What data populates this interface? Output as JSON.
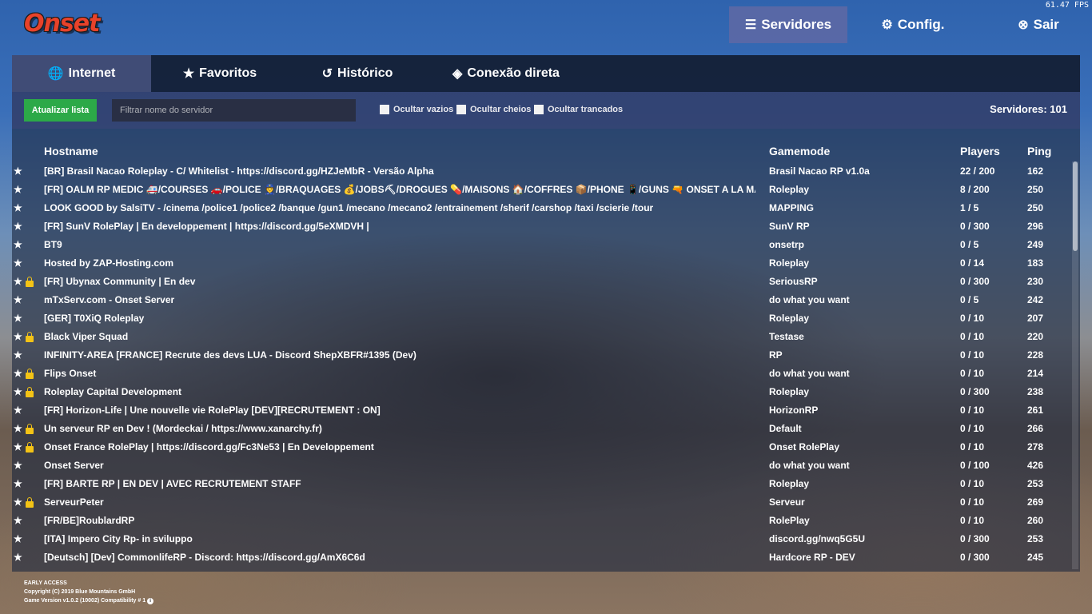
{
  "app": {
    "logo_text": "Onset",
    "fps": "61.47 FPS"
  },
  "topnav": {
    "servers": "Servidores",
    "config": "Config.",
    "exit": "Sair"
  },
  "tabs": [
    {
      "label": "Internet",
      "icon": "globe-icon",
      "active": true
    },
    {
      "label": "Favoritos",
      "icon": "star-icon",
      "active": false
    },
    {
      "label": "Histórico",
      "icon": "history-icon",
      "active": false
    },
    {
      "label": "Conexão direta",
      "icon": "direction-sign-icon",
      "active": false
    }
  ],
  "toolbar": {
    "refresh_label": "Atualizar lista",
    "filter_placeholder": "Filtrar nome do servidor",
    "hide_empty": "Ocultar vazios",
    "hide_full": "Ocultar cheios",
    "hide_locked": "Ocultar trancados",
    "server_count": "Servidores: 101"
  },
  "columns": {
    "hostname": "Hostname",
    "gamemode": "Gamemode",
    "players": "Players",
    "ping": "Ping"
  },
  "servers": [
    {
      "host": "[BR] Brasil Nacao Roleplay  - C/ Whitelist - https://discord.gg/HZJeMbR - Versão Alpha",
      "mode": "Brasil Nacao RP v1.0a",
      "players": "22 / 200",
      "ping": "162",
      "locked": false
    },
    {
      "host": "[FR] OALM RP MEDIC 🚑/COURSES 🚗/POLICE 👮/BRAQUAGES 💰/JOBS⛏/DROGUES 💊/MAISONS 🏠/COFFRES 📦/PHONE 📱/GUNS 🔫 ONSET A LA MAISON",
      "mode": "Roleplay",
      "players": "8 / 200",
      "ping": "250",
      "locked": false
    },
    {
      "host": "LOOK GOOD by SalsiTV -  /cinema /police1 /police2  /banque /gun1 /mecano /mecano2 /entrainement /sherif /carshop /taxi /scierie /tour",
      "mode": "MAPPING",
      "players": "1 / 5",
      "ping": "250",
      "locked": false
    },
    {
      "host": "[FR] SunV RolePlay | En developpement | https://discord.gg/5eXMDVH |",
      "mode": "SunV RP",
      "players": "0 / 300",
      "ping": "296",
      "locked": false
    },
    {
      "host": "BT9",
      "mode": "onsetrp",
      "players": "0 / 5",
      "ping": "249",
      "locked": false
    },
    {
      "host": "Hosted by ZAP-Hosting.com",
      "mode": "Roleplay",
      "players": "0 / 14",
      "ping": "183",
      "locked": false
    },
    {
      "host": "[FR] Ubynax Community | En dev",
      "mode": "SeriousRP",
      "players": "0 / 300",
      "ping": "230",
      "locked": true
    },
    {
      "host": "mTxServ.com - Onset Server",
      "mode": "do what you want",
      "players": "0 / 5",
      "ping": "242",
      "locked": false
    },
    {
      "host": "[GER] T0XiQ Roleplay",
      "mode": "Roleplay",
      "players": "0 / 10",
      "ping": "207",
      "locked": false
    },
    {
      "host": "Black Viper Squad",
      "mode": "Testase",
      "players": "0 / 10",
      "ping": "220",
      "locked": true
    },
    {
      "host": "INFINITY-AREA [FRANCE] Recrute des devs LUA - Discord ShepXBFR#1395 (Dev)",
      "mode": "RP",
      "players": "0 / 10",
      "ping": "228",
      "locked": false
    },
    {
      "host": "Flips Onset",
      "mode": "do what you want",
      "players": "0 / 10",
      "ping": "214",
      "locked": true
    },
    {
      "host": "Roleplay Capital Development",
      "mode": "Roleplay",
      "players": "0 / 300",
      "ping": "238",
      "locked": true
    },
    {
      "host": "[FR] Horizon-Life | Une nouvelle vie RolePlay [DEV][RECRUTEMENT : ON]",
      "mode": "HorizonRP",
      "players": "0 / 10",
      "ping": "261",
      "locked": false
    },
    {
      "host": "Un serveur RP en Dev ! (Mordeckai / https://www.xanarchy.fr)",
      "mode": "Default",
      "players": "0 / 10",
      "ping": "266",
      "locked": true
    },
    {
      "host": "Onset France RolePlay | https://discord.gg/Fc3Ne53 | En Developpement",
      "mode": "Onset RolePlay",
      "players": "0 / 10",
      "ping": "278",
      "locked": true
    },
    {
      "host": "Onset Server",
      "mode": "do what you want",
      "players": "0 / 100",
      "ping": "426",
      "locked": false
    },
    {
      "host": "[FR] BARTE RP | EN DEV | AVEC RECRUTEMENT STAFF",
      "mode": "Roleplay",
      "players": "0 / 10",
      "ping": "253",
      "locked": false
    },
    {
      "host": "ServeurPeter",
      "mode": "Serveur",
      "players": "0 / 10",
      "ping": "269",
      "locked": true
    },
    {
      "host": "[FR/BE]RoublardRP",
      "mode": "RolePlay",
      "players": "0 / 10",
      "ping": "260",
      "locked": false
    },
    {
      "host": "[ITA] Impero City Rp- in sviluppo",
      "mode": " discord.gg/nwq5G5U",
      "players": "0 / 300",
      "ping": "253",
      "locked": false
    },
    {
      "host": "[Deutsch] [Dev] CommonlifeRP - Discord: https://discord.gg/AmX6C6d",
      "mode": "Hardcore RP - DEV",
      "players": "0 / 300",
      "ping": "245",
      "locked": false
    }
  ],
  "footer": {
    "line1": "EARLY ACCESS",
    "line2": "Copyright (C) 2019 Blue Mountains GmbH",
    "line3": "Game Version v1.0.2 (10002) Compatibility # 1"
  },
  "colors": {
    "accent_active": "#5f69a5",
    "refresh_button": "#2ca948",
    "lock": "#f3c316",
    "logo": "#e8422a"
  }
}
